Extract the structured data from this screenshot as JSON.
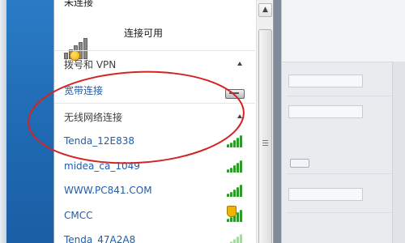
{
  "popup": {
    "top_cut_text": "未连接",
    "status": {
      "label": "连接可用"
    },
    "dialup": {
      "title": "拨号和 VPN",
      "items": [
        {
          "name": "宽带连接",
          "icon": "broadband-modem-icon"
        }
      ]
    },
    "wireless": {
      "title": "无线网络连接",
      "networks": [
        {
          "name": "Tenda_12E838",
          "icon": "signal-bars-icon",
          "secured": false
        },
        {
          "name": "midea_ca_1049",
          "icon": "signal-bars-icon",
          "secured": false
        },
        {
          "name": "WWW.PC841.COM",
          "icon": "signal-bars-icon",
          "secured": false
        },
        {
          "name": "CMCC",
          "icon": "signal-bars-icon",
          "secured": true
        },
        {
          "name": "Tenda_47A2A8",
          "icon": "signal-bars-icon",
          "secured": false
        }
      ]
    },
    "scroll": {
      "up_glyph": "▲",
      "grip_glyph": "≡"
    }
  },
  "colors": {
    "link": "#1f5da8",
    "signal": "#2f9a2c",
    "annotation": "#d42323",
    "desktop": "#1f6fb5"
  }
}
